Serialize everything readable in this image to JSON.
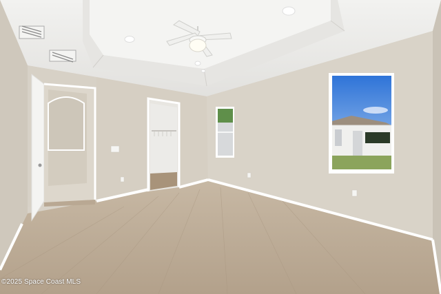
{
  "photo": {
    "watermark": "©2025 Space Coast MLS"
  },
  "colors": {
    "wall": "#d9d3c8",
    "wall_shadow": "#cbc4b8",
    "ceiling": "#ececea",
    "floor": "#b9a893",
    "trim": "#ffffff",
    "sky": "#4a86e0"
  }
}
